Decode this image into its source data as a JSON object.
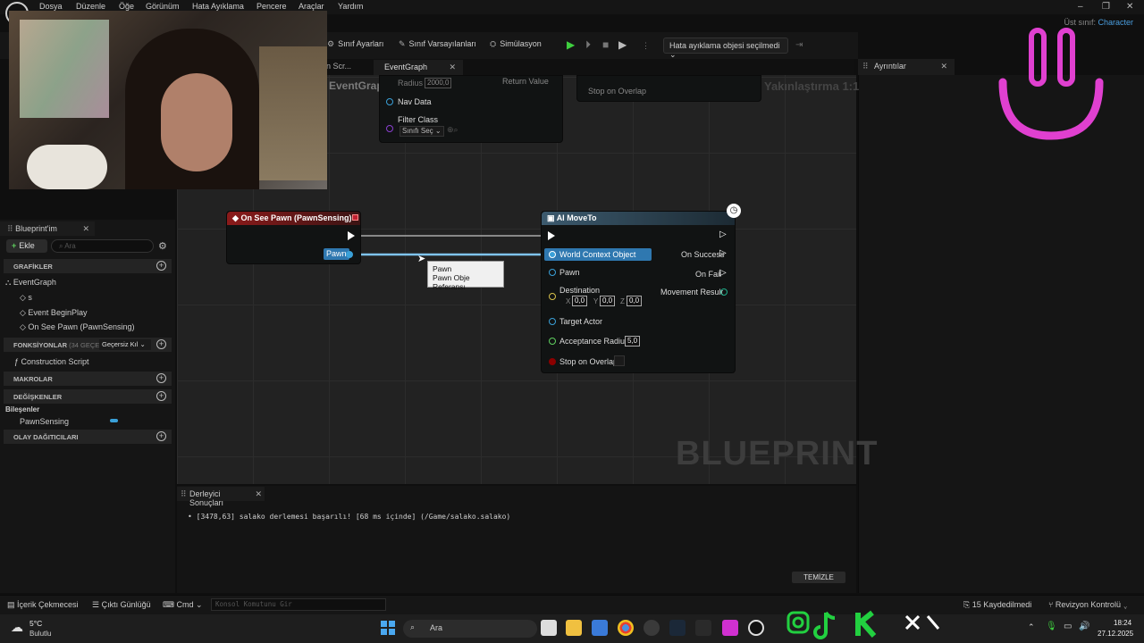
{
  "menu": {
    "items": [
      "Dosya",
      "Düzenle",
      "Öğe",
      "Görünüm",
      "Hata Ayıklama",
      "Pencere",
      "Araçlar",
      "Yardım"
    ],
    "parent_class_label": "Üst sınıf:",
    "parent_class_value": "Character"
  },
  "toolbar": {
    "class_settings": "Sınıf Ayarları",
    "class_defaults": "Sınıf Varsayılanları",
    "simulation": "Simülasyon",
    "debug_object": "Hata ayıklama objesi seçilmedi"
  },
  "tabs": {
    "prev_tab": "n Scr...",
    "event_graph": "EventGraph",
    "details": "Ayrıntılar"
  },
  "graph": {
    "title": "EventGraph",
    "zoom": "Yakınlaştırma 1:1",
    "watermark": "BLUEPRINT",
    "top_node": {
      "radius_label": "Radius",
      "radius_value": "2000,0",
      "return_value": "Return Value",
      "nav_data": "Nav Data",
      "filter_class": "Filter Class",
      "class_select": "Sınıfı Seç",
      "stop_on_overlap": "Stop on Overlap"
    },
    "on_see_pawn": {
      "title": "On See Pawn (PawnSensing)",
      "pawn_pin": "Pawn"
    },
    "ai_move_to": {
      "title": "AI MoveTo",
      "world_context": "World Context Object",
      "pawn": "Pawn",
      "destination": "Destination",
      "dest_x": "0,0",
      "dest_y": "0,0",
      "dest_z": "0,0",
      "target_actor": "Target Actor",
      "acceptance_radius": "Acceptance Radius",
      "acceptance_value": "5,0",
      "stop_on_overlap": "Stop on Overlap",
      "on_success": "On Success",
      "on_fail": "On Fail",
      "movement_result": "Movement Result"
    },
    "tooltip": {
      "line1": "Pawn",
      "line2": "Pawn Obje Referansı"
    }
  },
  "left_panel": {
    "tab": "Blueprint'im",
    "add": "Ekle",
    "search_placeholder": "Ara",
    "graphs_header": "GRAFİKLER",
    "event_graph": "EventGraph",
    "item_s": "s",
    "event_begin_play": "Event BeginPlay",
    "on_see_pawn": "On See Pawn (PawnSensing)",
    "functions_header": "FONKSİYONLAR",
    "functions_count": "(34 GEÇERS",
    "invalid_select": "Geçersiz Kıl",
    "construction_script": "Construction Script",
    "macros_header": "MAKROLAR",
    "variables_header": "DEĞİŞKENLER",
    "components_header": "Bileşenler",
    "pawn_sensing": "PawnSensing",
    "event_dispatchers_header": "OLAY DAĞITICILARI"
  },
  "compiler": {
    "tab": "Derleyici Sonuçları",
    "message": "[3478,63] salako derlemesi başarılı! [68 ms içinde] (/Game/salako.salako)",
    "clear": "TEMİZLE"
  },
  "statusbar": {
    "content_drawer": "İçerik Çekmecesi",
    "output_log": "Çıktı Günlüğü",
    "cmd": "Cmd",
    "console_placeholder": "Konsol Komutunu Gir",
    "unsaved": "15 Kaydedilmedi",
    "revision": "Revizyon Kontrolü"
  },
  "taskbar": {
    "temperature": "5°C",
    "weather": "Bulutlu",
    "search": "Ara",
    "time": "18:24",
    "date": "27.12.2025"
  },
  "colors": {
    "event_head": "#8b1a1a",
    "function_head": "#3c5a6e",
    "object_pin": "#3aa0d8",
    "vector_pin": "#d8c14a",
    "float_pin": "#5fcf5f",
    "bool_pin": "#8b0000",
    "accent": "#4a9fe0",
    "overlay_pink": "#e040d0",
    "overlay_green": "#22d040"
  }
}
